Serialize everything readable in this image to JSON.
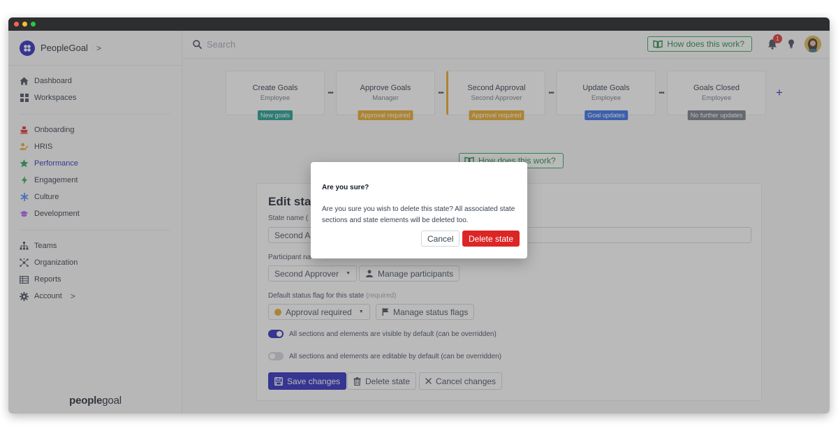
{
  "brand": {
    "name": "PeopleGoal",
    "chevron": ">"
  },
  "sidebar": {
    "top_items": [
      {
        "label": "Dashboard",
        "icon": "home-icon"
      },
      {
        "label": "Workspaces",
        "icon": "grid-icon"
      }
    ],
    "module_items": [
      {
        "label": "Onboarding",
        "icon": "ship-icon",
        "color": "#dc2626"
      },
      {
        "label": "HRIS",
        "icon": "users-icon",
        "color": "#e8a317"
      },
      {
        "label": "Performance",
        "icon": "star-icon",
        "color": "#16a34a",
        "active": true
      },
      {
        "label": "Engagement",
        "icon": "bolt-icon",
        "color": "#16a34a"
      },
      {
        "label": "Culture",
        "icon": "asterisk-icon",
        "color": "#3b82f6"
      },
      {
        "label": "Development",
        "icon": "graduation-cap-icon",
        "color": "#a855f7"
      }
    ],
    "bottom_items": [
      {
        "label": "Teams",
        "icon": "sitemap-icon"
      },
      {
        "label": "Organization",
        "icon": "network-icon"
      },
      {
        "label": "Reports",
        "icon": "table-icon"
      },
      {
        "label": "Account",
        "icon": "gear-icon",
        "chevron": ">"
      }
    ],
    "footer": {
      "bold": "people",
      "regular": "goal"
    }
  },
  "topbar": {
    "search_placeholder": "Search",
    "how_label": "How does this work?",
    "notification_count": "1"
  },
  "workflow": {
    "stages": [
      {
        "name": "Create Goals",
        "role": "Employee",
        "flag": "New goals",
        "flag_color": "#0d9488"
      },
      {
        "name": "Approve Goals",
        "role": "Manager",
        "flag": "Approval required",
        "flag_color": "#e8a317"
      },
      {
        "name": "Second Approval",
        "role": "Second Approver",
        "flag": "Approval required",
        "flag_color": "#e8a317",
        "selected": true
      },
      {
        "name": "Update Goals",
        "role": "Employee",
        "flag": "Goal updates",
        "flag_color": "#2563eb"
      },
      {
        "name": "Goals Closed",
        "role": "Employee",
        "flag": "No further updates",
        "flag_color": "#6b7280"
      }
    ],
    "separator": "•••",
    "add_label": "+"
  },
  "main": {
    "how_label": "How does this work?"
  },
  "edit": {
    "title": "Edit sta",
    "state_name_label": "State name (",
    "state_name_value": "Second Ap",
    "participant_label": "Participant na",
    "participant_value": "Second Approver",
    "manage_participants": "Manage participants",
    "flag_label": "Default status flag for this state",
    "flag_required": "(required)",
    "flag_value": "Approval required",
    "manage_flags": "Manage status flags",
    "toggle_visible": "All sections and elements are visible by default (can be overridden)",
    "toggle_editable": "All sections and elements are editable by default (can be overridden)",
    "save_label": "Save changes",
    "delete_label": "Delete state",
    "cancel_label": "Cancel changes"
  },
  "modal": {
    "title": "Are you sure?",
    "body": "Are you sure you wish to delete this state? All associated state sections and state elements will be deleted too.",
    "cancel_label": "Cancel",
    "delete_label": "Delete state"
  },
  "colors": {
    "accent": "#1d1ab8",
    "danger": "#dc2626",
    "success": "#16a34a",
    "warning": "#e8a317"
  }
}
